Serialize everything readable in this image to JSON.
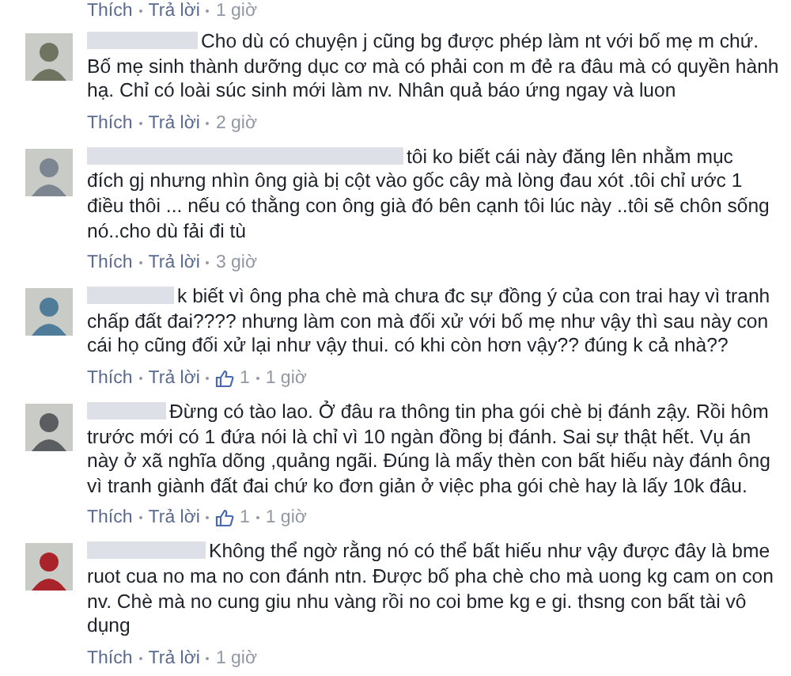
{
  "previous_actions": {
    "like": "Thích",
    "reply": "Trả lời",
    "time": "1 giờ"
  },
  "comments": [
    {
      "lines": [
        "Cho dù có chuyện j cũng bg được phép làm nt với bố mẹ m chứ.",
        "Bố mẹ sinh thành dưỡng dục cơ mà có phải con m đẻ ra đâu mà có quyền hành",
        "hạ. Chỉ có loài súc sinh mới làm nv. Nhân quả báo ứng ngay và luon"
      ],
      "like": "Thích",
      "reply": "Trả lời",
      "time": "2 giờ"
    },
    {
      "lines": [
        "tôi ko biết cái này đăng lên nhằm mục",
        "đích gj nhưng nhìn ông già bị cột vào gốc cây mà lòng đau xót .tôi chỉ ước 1",
        "điều thôi ... nếu có thằng con ông già đó bên cạnh tôi lúc này ..tôi sẽ chôn sống",
        "nó..cho dù fải đi tù"
      ],
      "like": "Thích",
      "reply": "Trả lời",
      "time": "3 giờ"
    },
    {
      "lines": [
        "k biết vì ông pha chè mà chưa đc sự đồng ý của con trai hay vì tranh",
        "chấp đất đai???? nhưng làm con mà đối xử với bố mẹ như vậy thì sau này con",
        "cái họ cũng đối xử lại như vậy thui. có khi còn hơn vậy?? đúng k cả nhà??"
      ],
      "like": "Thích",
      "reply": "Trả lời",
      "likes": "1",
      "time": "1 giờ"
    },
    {
      "lines": [
        "Đừng có tào lao. Ở đâu ra thông tin pha gói chè bị đánh zậy. Rồi hôm",
        "trước mới có 1 đứa nói là chỉ vì 10 ngàn đồng bị đánh. Sai sự thật hết. Vụ án",
        "này ở xã nghĩa dõng ,quảng ngãi. Đúng là mấy thèn con bất hiếu này đánh ông",
        "vì tranh giành đất đai chứ ko đơn giản ở việc pha gói chè hay là lấy 10k đâu."
      ],
      "like": "Thích",
      "reply": "Trả lời",
      "likes": "1",
      "time": "1 giờ"
    },
    {
      "lines": [
        "Không thể ngờ rằng nó có thể bất hiếu như vậy được đây là bme",
        "ruot cua no ma no con đánh ntn. Được bố pha chè cho mà uong kg cam on con",
        "nv. Chè mà no cung giu nhu vàng rồi no coi bme kg e gi. thsng con bất tài vô",
        "dụng"
      ],
      "like": "Thích",
      "reply": "Trả lời",
      "time": "1 giờ"
    }
  ]
}
